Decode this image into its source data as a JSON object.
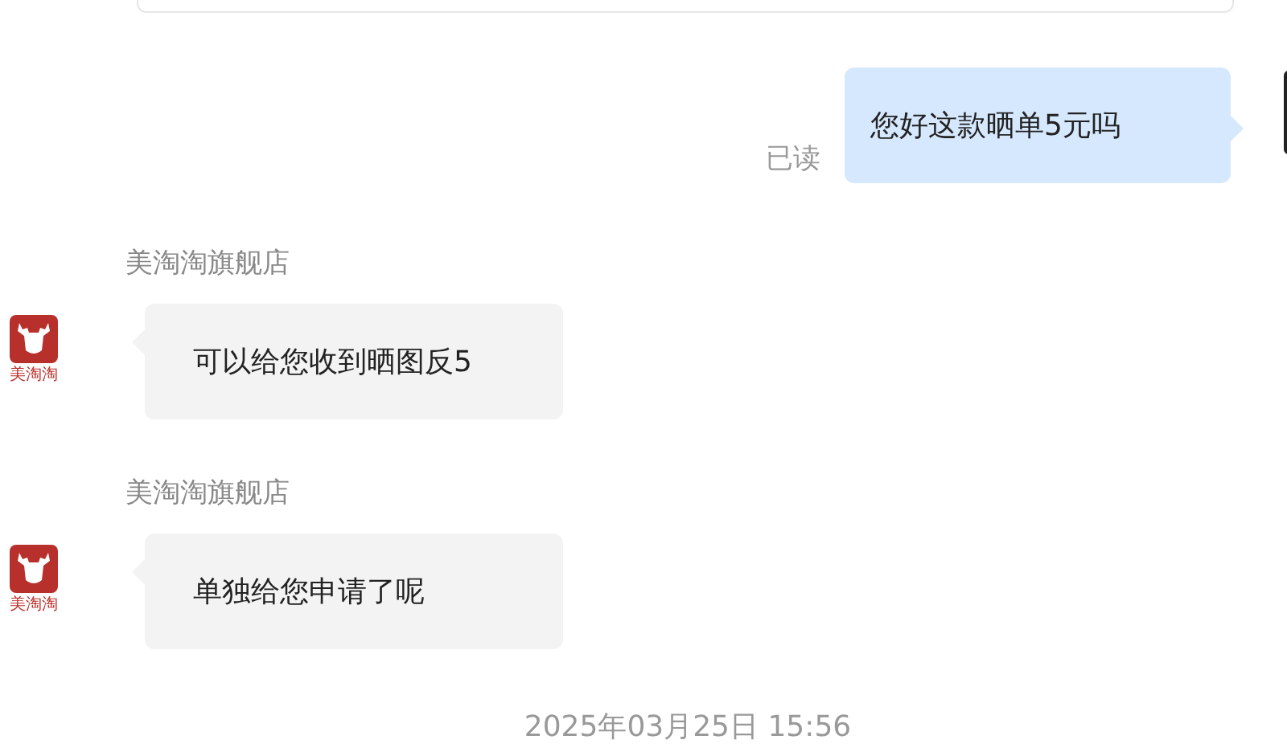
{
  "messages": [
    {
      "kind": "sent",
      "text": "您好这款晒单5元吗",
      "status": "已读"
    },
    {
      "kind": "received",
      "sender": "美淘淘旗舰店",
      "avatar_label": "美淘淘",
      "text": "可以给您收到晒图反5"
    },
    {
      "kind": "received",
      "sender": "美淘淘旗舰店",
      "avatar_label": "美淘淘",
      "text": "单独给您申请了呢"
    }
  ],
  "timestamp": "2025年03月25日  15:56"
}
